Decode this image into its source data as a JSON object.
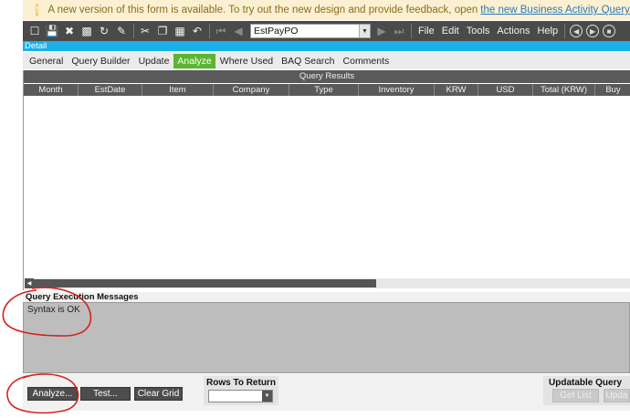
{
  "notice": {
    "text": "A new version of this form is available. To try out the new design and provide feedback, open",
    "link": "the new Business Activity Query (BAQ) app."
  },
  "toolbar": {
    "query_name": "EstPayPO",
    "menus": [
      "File",
      "Edit",
      "Tools",
      "Actions",
      "Help"
    ]
  },
  "detail": {
    "label": "Detail"
  },
  "tabs": [
    {
      "label": "General"
    },
    {
      "label": "Query Builder"
    },
    {
      "label": "Update"
    },
    {
      "label": "Analyze",
      "active": true
    },
    {
      "label": "Where Used"
    },
    {
      "label": "BAQ Search"
    },
    {
      "label": "Comments"
    }
  ],
  "grid": {
    "caption": "Query Results",
    "columns": [
      "Month",
      "EstDate",
      "Item",
      "Company",
      "Type",
      "Inventory",
      "KRW",
      "USD",
      "Total (KRW)",
      "Buy"
    ]
  },
  "messages": {
    "title": "Query Execution Messages",
    "text": "Syntax is OK"
  },
  "bottom": {
    "analyze_label": "Analyze...",
    "test_label": "Test...",
    "clear_label": "Clear Grid",
    "rows_label": "Rows To Return",
    "rows_value": "",
    "updatable_label": "Updatable Query",
    "get_list_label": "Get List",
    "update_label": "Upda"
  },
  "colors": {
    "accent_blue": "#1ab0e8",
    "active_tab": "#5cb531",
    "annotation": "#d62020"
  }
}
